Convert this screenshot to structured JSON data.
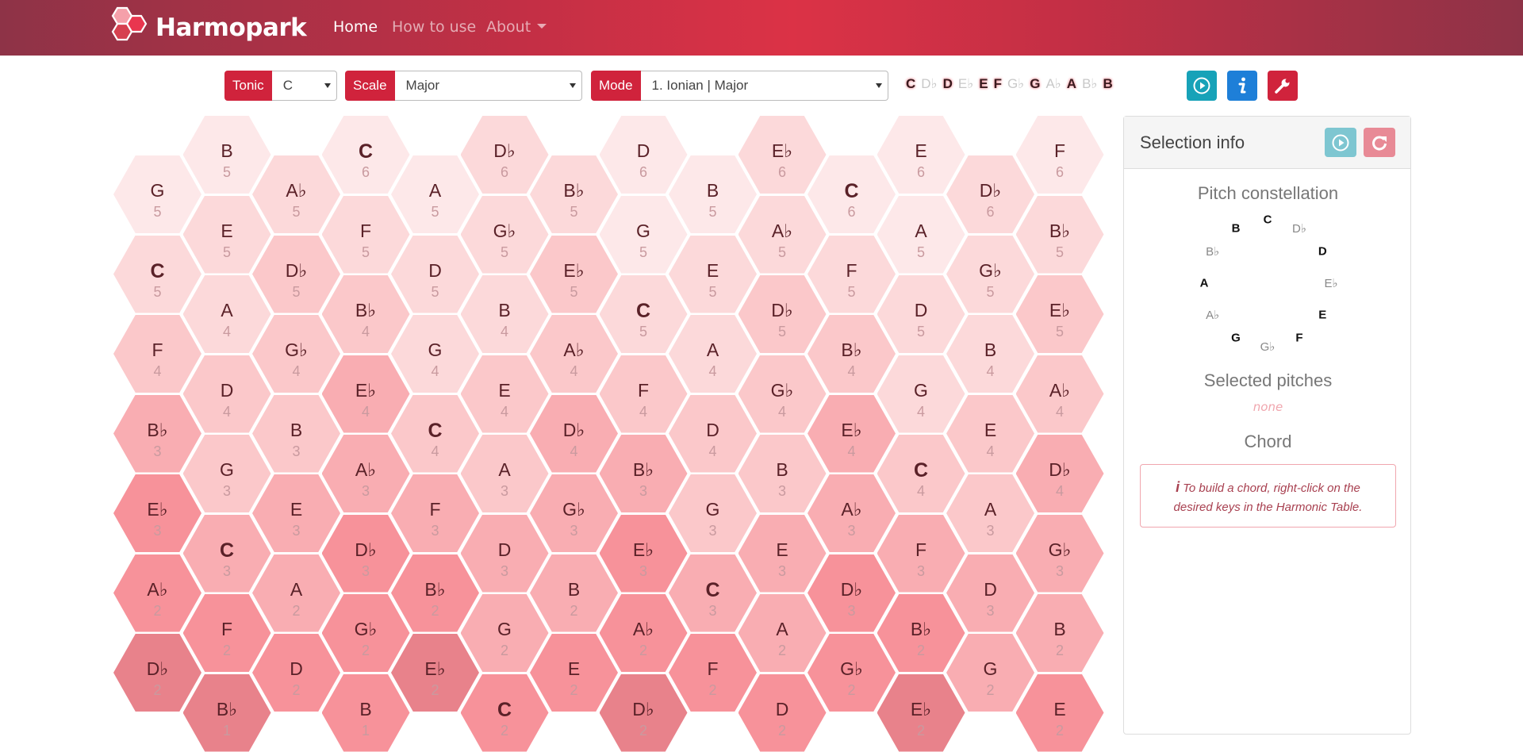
{
  "nav": {
    "brand": "Harmopark",
    "links": [
      {
        "label": "Home",
        "active": true
      },
      {
        "label": "How to use",
        "active": false
      },
      {
        "label": "About",
        "active": false,
        "dropdown": true
      }
    ]
  },
  "toolbar": {
    "tonic": {
      "label": "Tonic",
      "value": "C"
    },
    "scale": {
      "label": "Scale",
      "value": "Major"
    },
    "mode": {
      "label": "Mode",
      "value": "1. Ionian | Major"
    },
    "notes": [
      {
        "name": "C",
        "on": true
      },
      {
        "name": "D♭",
        "on": false
      },
      {
        "name": "D",
        "on": true
      },
      {
        "name": "E♭",
        "on": false
      },
      {
        "name": "E",
        "on": true
      },
      {
        "name": "F",
        "on": true
      },
      {
        "name": "G♭",
        "on": false
      },
      {
        "name": "G",
        "on": true
      },
      {
        "name": "A♭",
        "on": false
      },
      {
        "name": "A",
        "on": true
      },
      {
        "name": "B♭",
        "on": false
      },
      {
        "name": "B",
        "on": true
      }
    ],
    "buttons": [
      {
        "icon": "play-icon",
        "color": "#17a2b8"
      },
      {
        "icon": "info-icon",
        "color": "#1e7fd8"
      },
      {
        "icon": "wrench-icon",
        "color": "#d0233c"
      }
    ]
  },
  "grid": {
    "tonic": "C",
    "colors": [
      "#fde8e9",
      "#fcd9da",
      "#fbc8ca",
      "#f9adb2",
      "#f7929a",
      "#e8828b"
    ],
    "columns": [
      [
        [
          "G",
          5
        ],
        [
          "C",
          5
        ],
        [
          "F",
          4
        ],
        [
          "B♭",
          3
        ],
        [
          "E♭",
          3
        ],
        [
          "A♭",
          2
        ],
        [
          "D♭",
          2
        ]
      ],
      [
        [
          "B",
          5
        ],
        [
          "E",
          5
        ],
        [
          "A",
          4
        ],
        [
          "D",
          4
        ],
        [
          "G",
          3
        ],
        [
          "C",
          3
        ],
        [
          "F",
          2
        ],
        [
          "B♭",
          1
        ]
      ],
      [
        [
          "A♭",
          5
        ],
        [
          "D♭",
          5
        ],
        [
          "G♭",
          4
        ],
        [
          "B",
          3
        ],
        [
          "E",
          3
        ],
        [
          "A",
          2
        ],
        [
          "D",
          2
        ]
      ],
      [
        [
          "C",
          6
        ],
        [
          "F",
          5
        ],
        [
          "B♭",
          4
        ],
        [
          "E♭",
          4
        ],
        [
          "A♭",
          3
        ],
        [
          "D♭",
          3
        ],
        [
          "G♭",
          2
        ],
        [
          "B",
          1
        ]
      ],
      [
        [
          "A",
          5
        ],
        [
          "D",
          5
        ],
        [
          "G",
          4
        ],
        [
          "C",
          4
        ],
        [
          "F",
          3
        ],
        [
          "B♭",
          2
        ],
        [
          "E♭",
          2
        ]
      ],
      [
        [
          "D♭",
          6
        ],
        [
          "G♭",
          5
        ],
        [
          "B",
          4
        ],
        [
          "E",
          4
        ],
        [
          "A",
          3
        ],
        [
          "D",
          3
        ],
        [
          "G",
          2
        ],
        [
          "C",
          2
        ]
      ],
      [
        [
          "B♭",
          5
        ],
        [
          "E♭",
          5
        ],
        [
          "A♭",
          4
        ],
        [
          "D♭",
          4
        ],
        [
          "G♭",
          3
        ],
        [
          "B",
          2
        ],
        [
          "E",
          2
        ]
      ],
      [
        [
          "D",
          6
        ],
        [
          "G",
          5
        ],
        [
          "C",
          5
        ],
        [
          "F",
          4
        ],
        [
          "B♭",
          3
        ],
        [
          "E♭",
          3
        ],
        [
          "A♭",
          2
        ],
        [
          "D♭",
          2
        ]
      ],
      [
        [
          "B",
          5
        ],
        [
          "E",
          5
        ],
        [
          "A",
          4
        ],
        [
          "D",
          4
        ],
        [
          "G",
          3
        ],
        [
          "C",
          3
        ],
        [
          "F",
          2
        ]
      ],
      [
        [
          "E♭",
          6
        ],
        [
          "A♭",
          5
        ],
        [
          "D♭",
          5
        ],
        [
          "G♭",
          4
        ],
        [
          "B",
          3
        ],
        [
          "E",
          3
        ],
        [
          "A",
          2
        ],
        [
          "D",
          2
        ]
      ],
      [
        [
          "C",
          6
        ],
        [
          "F",
          5
        ],
        [
          "B♭",
          4
        ],
        [
          "E♭",
          4
        ],
        [
          "A♭",
          3
        ],
        [
          "D♭",
          3
        ],
        [
          "G♭",
          2
        ]
      ],
      [
        [
          "E",
          6
        ],
        [
          "A",
          5
        ],
        [
          "D",
          5
        ],
        [
          "G",
          4
        ],
        [
          "C",
          4
        ],
        [
          "F",
          3
        ],
        [
          "B♭",
          2
        ],
        [
          "E♭",
          2
        ]
      ],
      [
        [
          "D♭",
          6
        ],
        [
          "G♭",
          5
        ],
        [
          "B",
          4
        ],
        [
          "E",
          4
        ],
        [
          "A",
          3
        ],
        [
          "D",
          3
        ],
        [
          "G",
          2
        ]
      ],
      [
        [
          "F",
          6
        ],
        [
          "B♭",
          5
        ],
        [
          "E♭",
          5
        ],
        [
          "A♭",
          4
        ],
        [
          "D♭",
          4
        ],
        [
          "G♭",
          3
        ],
        [
          "B",
          2
        ],
        [
          "E",
          2
        ]
      ]
    ]
  },
  "panel": {
    "title": "Selection info",
    "constellation_title": "Pitch constellation",
    "constellation": [
      {
        "name": "C",
        "on": true
      },
      {
        "name": "D♭",
        "on": false
      },
      {
        "name": "D",
        "on": true
      },
      {
        "name": "E♭",
        "on": false
      },
      {
        "name": "E",
        "on": true
      },
      {
        "name": "F",
        "on": true
      },
      {
        "name": "G♭",
        "on": false
      },
      {
        "name": "G",
        "on": true
      },
      {
        "name": "A♭",
        "on": false
      },
      {
        "name": "A",
        "on": true
      },
      {
        "name": "B♭",
        "on": false
      },
      {
        "name": "B",
        "on": true
      }
    ],
    "selected_title": "Selected pitches",
    "selected_value": "none",
    "chord_title": "Chord",
    "chord_hint": "To build a chord, right-click on the desired keys in the Harmonic Table."
  }
}
